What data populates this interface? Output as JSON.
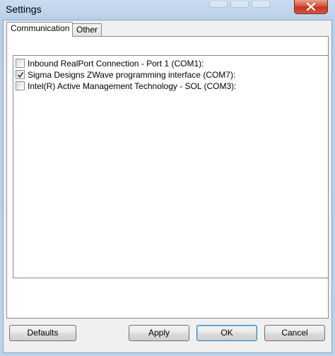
{
  "window": {
    "title": "Settings"
  },
  "tabs": [
    {
      "label": "Communication",
      "active": true
    },
    {
      "label": "Other",
      "active": false
    }
  ],
  "ports": [
    {
      "label": "Inbound RealPort Connection - Port 1 (COM1):",
      "checked": false
    },
    {
      "label": "Sigma Designs ZWave programming interface (COM7):",
      "checked": true
    },
    {
      "label": "Intel(R) Active Management Technology - SOL (COM3):",
      "checked": false
    }
  ],
  "buttons": {
    "defaults": "Defaults",
    "apply": "Apply",
    "ok": "OK",
    "cancel": "Cancel"
  },
  "icons": {
    "close": "close-icon",
    "check": "checkmark-icon"
  },
  "colors": {
    "frame": "#bcd2ea",
    "close_button": "#c4321b",
    "default_button_border": "#3c7fb1"
  }
}
